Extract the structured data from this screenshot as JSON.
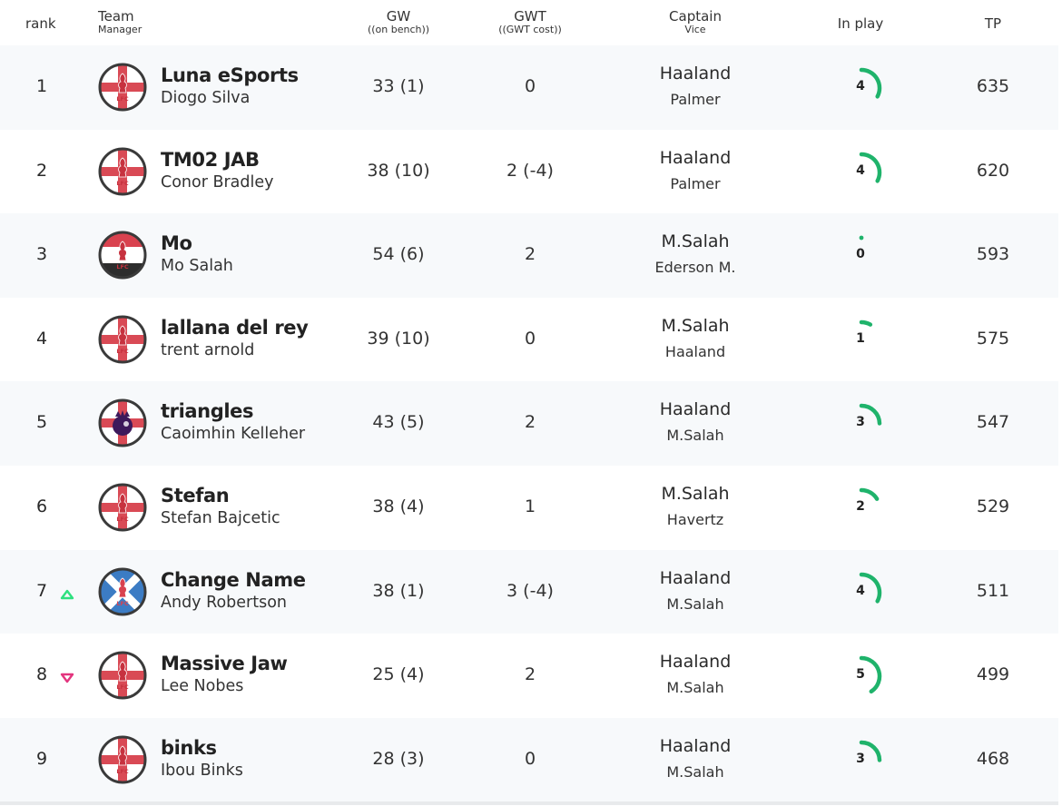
{
  "header": {
    "rank": "rank",
    "team": "Team",
    "manager": "Manager",
    "gw": "GW",
    "gw_sub": "((on bench))",
    "gwt": "GWT",
    "gwt_sub": "((GWT cost))",
    "captain": "Captain",
    "vice": "Vice",
    "in_play": "In play",
    "tp": "TP"
  },
  "colors": {
    "arc": "#1fb36b",
    "up": "#2ee07f",
    "down": "#e3357e",
    "cross_red": "#d94a55",
    "row_alt": "#f7f9fb"
  },
  "in_play_max": 11,
  "rows": [
    {
      "rank": "1",
      "movement": "none",
      "badge": "england-lfc",
      "team": "Luna eSports",
      "manager": "Diogo Silva",
      "gw": "33 (1)",
      "gwt": "0",
      "captain": "Haaland",
      "vice": "Palmer",
      "in_play": 4,
      "in_play_label": "4",
      "tp": "635"
    },
    {
      "rank": "2",
      "movement": "none",
      "badge": "england-lfc",
      "team": "TM02 JAB",
      "manager": "Conor Bradley",
      "gw": "38 (10)",
      "gwt": "2 (-4)",
      "captain": "Haaland",
      "vice": "Palmer",
      "in_play": 4,
      "in_play_label": "4",
      "tp": "620"
    },
    {
      "rank": "3",
      "movement": "none",
      "badge": "egypt-lfc",
      "team": "Mo",
      "manager": "Mo Salah",
      "gw": "54 (6)",
      "gwt": "2",
      "captain": "M.Salah",
      "vice": "Ederson M.",
      "in_play": 0,
      "in_play_label": "0",
      "tp": "593"
    },
    {
      "rank": "4",
      "movement": "none",
      "badge": "england-lfc",
      "team": "lallana del rey",
      "manager": "trent arnold",
      "gw": "39 (10)",
      "gwt": "0",
      "captain": "M.Salah",
      "vice": "Haaland",
      "in_play": 1,
      "in_play_label": "1",
      "tp": "575"
    },
    {
      "rank": "5",
      "movement": "none",
      "badge": "england-pl",
      "team": "triangles",
      "manager": "Caoimhin Kelleher",
      "gw": "43 (5)",
      "gwt": "2",
      "captain": "Haaland",
      "vice": "M.Salah",
      "in_play": 3,
      "in_play_label": "3",
      "tp": "547"
    },
    {
      "rank": "6",
      "movement": "none",
      "badge": "england-lfc",
      "team": "Stefan",
      "manager": "Stefan Bajcetic",
      "gw": "38 (4)",
      "gwt": "1",
      "captain": "M.Salah",
      "vice": "Havertz",
      "in_play": 2,
      "in_play_label": "2",
      "tp": "529"
    },
    {
      "rank": "7",
      "movement": "up",
      "badge": "scotland-lfc",
      "team": "Change Name",
      "manager": "Andy Robertson",
      "gw": "38 (1)",
      "gwt": "3 (-4)",
      "captain": "Haaland",
      "vice": "M.Salah",
      "in_play": 4,
      "in_play_label": "4",
      "tp": "511"
    },
    {
      "rank": "8",
      "movement": "down",
      "badge": "england-lfc",
      "team": "Massive Jaw",
      "manager": "Lee Nobes",
      "gw": "25 (4)",
      "gwt": "2",
      "captain": "Haaland",
      "vice": "M.Salah",
      "in_play": 5,
      "in_play_label": "5",
      "tp": "499"
    },
    {
      "rank": "9",
      "movement": "none",
      "badge": "england-lfc",
      "team": "binks",
      "manager": "Ibou Binks",
      "gw": "28 (3)",
      "gwt": "0",
      "captain": "Haaland",
      "vice": "M.Salah",
      "in_play": 3,
      "in_play_label": "3",
      "tp": "468"
    }
  ]
}
